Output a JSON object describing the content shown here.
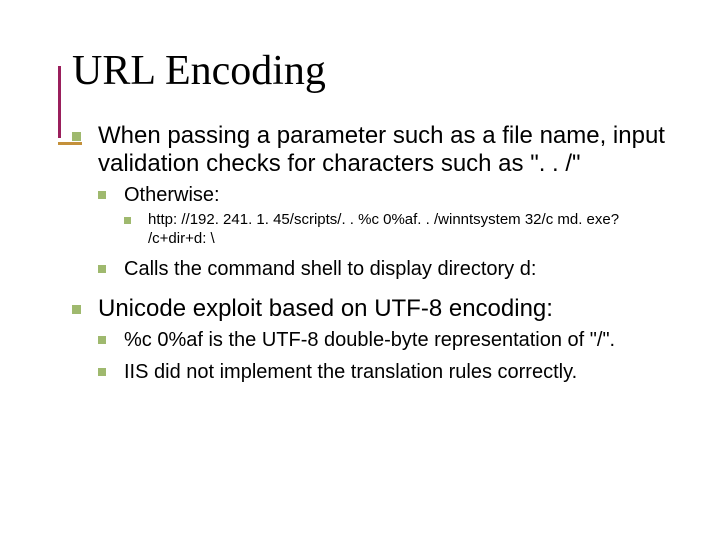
{
  "title": "URL Encoding",
  "bullets": {
    "b1": "When passing a parameter such as a file name, input validation checks for characters such as \". . /\"",
    "b1a": "Otherwise:",
    "b1a_i": "http: //192. 241. 1. 45/scripts/. . %c 0%af. . /winntsystem 32/c md. exe? /c+dir+d: \\",
    "b1b": "Calls the command shell to display directory d:",
    "b2": "Unicode exploit based on UTF-8 encoding:",
    "b2a": "%c 0%af is the UTF-8 double-byte representation of \"/\".",
    "b2b": "IIS did not implement the translation rules correctly."
  }
}
